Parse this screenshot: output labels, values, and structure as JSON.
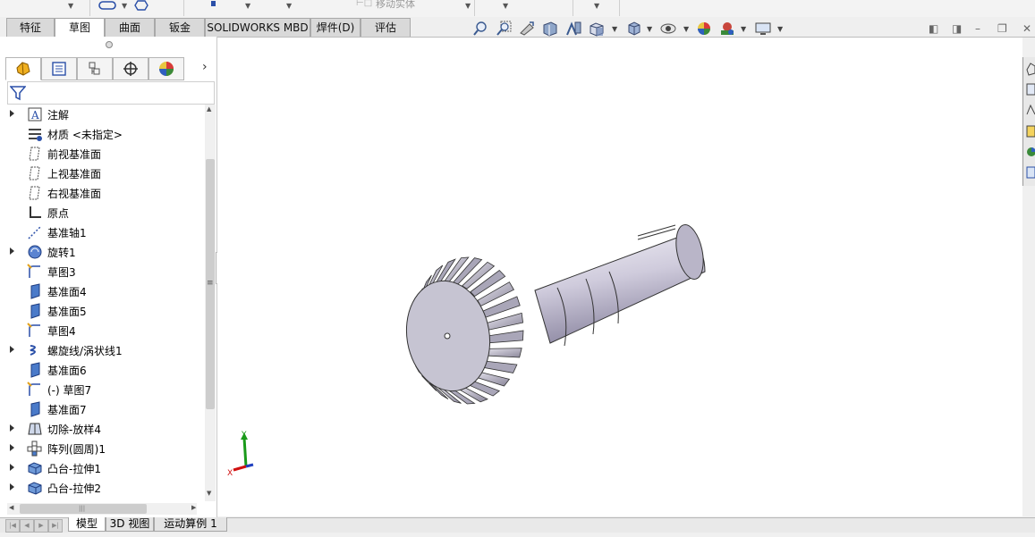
{
  "toolbar": {
    "move_entity_label": "移动实体"
  },
  "command_tabs": [
    {
      "label": "特征",
      "active": false
    },
    {
      "label": "草图",
      "active": true
    },
    {
      "label": "曲面",
      "active": false
    },
    {
      "label": "钣金",
      "active": false
    },
    {
      "label": "SOLIDWORKS MBD",
      "active": false
    },
    {
      "label": "焊件(D)",
      "active": false
    },
    {
      "label": "评估",
      "active": false
    }
  ],
  "view_toolbar_icons": [
    "zoom-to-fit-icon",
    "zoom-to-area-icon",
    "previous-view-icon",
    "section-view-icon",
    "dynamic-annotation-icon",
    "view-orientation-icon",
    "display-style-icon",
    "hide-show-icon",
    "edit-appearance-icon",
    "apply-scene-icon",
    "view-settings-icon"
  ],
  "panel_tabs": [
    "feature-manager-icon",
    "property-manager-icon",
    "configuration-manager-icon",
    "dimxpert-manager-icon",
    "display-manager-icon"
  ],
  "feature_tree": [
    {
      "label": "注解",
      "icon": "annotations-icon",
      "expandable": true
    },
    {
      "label": "材质 <未指定>",
      "icon": "material-icon",
      "expandable": false
    },
    {
      "label": "前视基准面",
      "icon": "plane-icon",
      "expandable": false
    },
    {
      "label": "上视基准面",
      "icon": "plane-icon",
      "expandable": false
    },
    {
      "label": "右视基准面",
      "icon": "plane-icon",
      "expandable": false
    },
    {
      "label": "原点",
      "icon": "origin-icon",
      "expandable": false
    },
    {
      "label": "基准轴1",
      "icon": "axis-icon",
      "expandable": false
    },
    {
      "label": "旋转1",
      "icon": "revolve-icon",
      "expandable": true
    },
    {
      "label": "草图3",
      "icon": "sketch-icon",
      "expandable": false
    },
    {
      "label": "基准面4",
      "icon": "ref-plane-icon",
      "expandable": false
    },
    {
      "label": "基准面5",
      "icon": "ref-plane-icon",
      "expandable": false
    },
    {
      "label": "草图4",
      "icon": "sketch-icon",
      "expandable": false
    },
    {
      "label": "螺旋线/涡状线1",
      "icon": "helix-icon",
      "expandable": true
    },
    {
      "label": "基准面6",
      "icon": "ref-plane-icon",
      "expandable": false
    },
    {
      "label": "(-) 草图7",
      "icon": "sketch-icon",
      "expandable": false
    },
    {
      "label": "基准面7",
      "icon": "ref-plane-icon",
      "expandable": false
    },
    {
      "label": "切除-放样4",
      "icon": "cut-loft-icon",
      "expandable": true
    },
    {
      "label": "阵列(圆周)1",
      "icon": "circular-pattern-icon",
      "expandable": true
    },
    {
      "label": "凸台-拉伸1",
      "icon": "boss-extrude-icon",
      "expandable": true
    },
    {
      "label": "凸台-拉伸2",
      "icon": "boss-extrude-icon",
      "expandable": true
    }
  ],
  "bottom_tabs": [
    {
      "label": "模型",
      "active": true
    },
    {
      "label": "3D 视图",
      "active": false
    },
    {
      "label": "运动算例 1",
      "active": false
    }
  ],
  "triad": {
    "y_label": "Y",
    "x_label": "X"
  },
  "colors": {
    "viewport_bg": "#ffffff",
    "part_gray": "#b7b4c4",
    "axis_green": "#1a9a1a",
    "axis_red": "#d01010",
    "axis_blue": "#2040c0"
  }
}
